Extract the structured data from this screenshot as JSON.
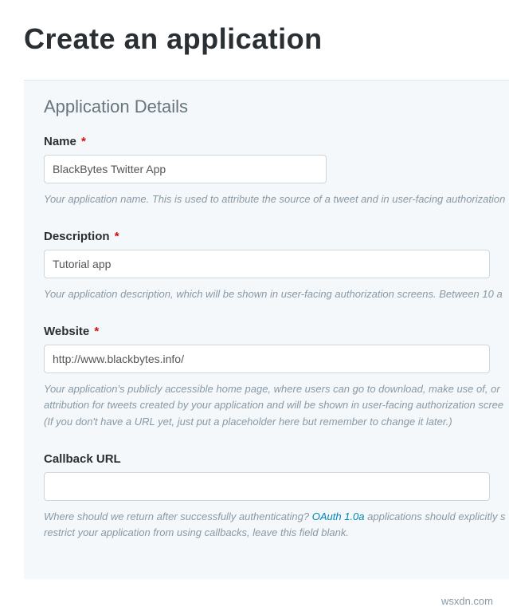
{
  "page": {
    "title": "Create an application"
  },
  "panel": {
    "section_title": "Application Details"
  },
  "fields": {
    "name": {
      "label": "Name",
      "required": "*",
      "value": "BlackBytes Twitter App",
      "help": "Your application name. This is used to attribute the source of a tweet and in user-facing authorization"
    },
    "description": {
      "label": "Description",
      "required": "*",
      "value": "Tutorial app",
      "help": "Your application description, which will be shown in user-facing authorization screens. Between 10 a"
    },
    "website": {
      "label": "Website",
      "required": "*",
      "value": "http://www.blackbytes.info/",
      "help_line1": "Your application's publicly accessible home page, where users can go to download, make use of, or",
      "help_line2": "attribution for tweets created by your application and will be shown in user-facing authorization scree",
      "help_line3": "(If you don't have a URL yet, just put a placeholder here but remember to change it later.)"
    },
    "callback": {
      "label": "Callback URL",
      "value": "",
      "help_before_link": "Where should we return after successfully authenticating? ",
      "help_link": "OAuth 1.0a",
      "help_after_link": " applications should explicitly s",
      "help_line2": "restrict your application from using callbacks, leave this field blank."
    }
  },
  "footer": {
    "text": "wsxdn.com"
  }
}
